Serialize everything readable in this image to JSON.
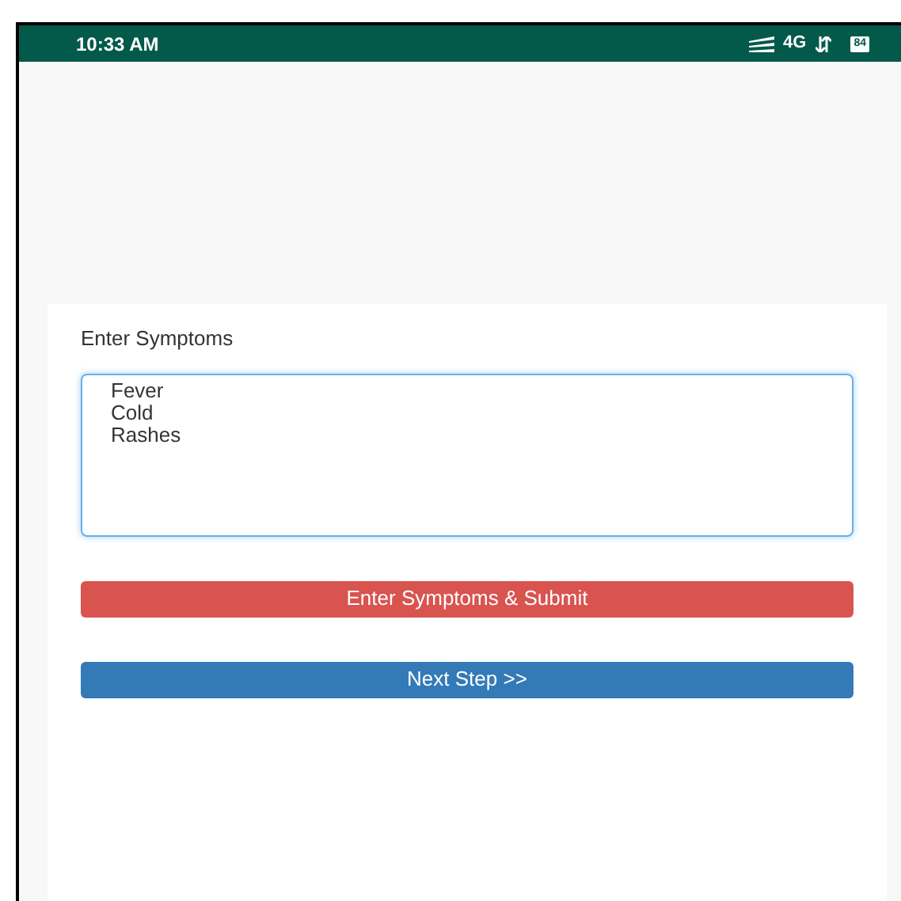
{
  "status_bar": {
    "time": "10:33 AM",
    "network": "4G",
    "battery": "84"
  },
  "form": {
    "label": "Enter Symptoms",
    "symptoms_value": "Fever\nCold\nRashes",
    "focused": true
  },
  "buttons": [
    {
      "label": "Enter Symptoms & Submit",
      "kind": "danger"
    },
    {
      "label": "Next Step >>",
      "kind": "primary"
    }
  ]
}
